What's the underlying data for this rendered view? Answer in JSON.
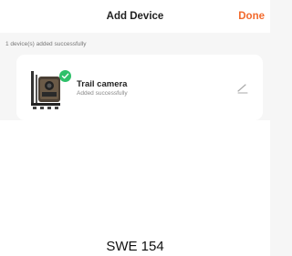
{
  "header": {
    "title": "Add Device",
    "done_label": "Done"
  },
  "status_text": "1 device(s) added successfully",
  "device": {
    "name": "Trail camera",
    "status": "Added successfully",
    "icon": "trail-camera-thumbnail",
    "edit_icon": "pencil-icon"
  },
  "footer": {
    "caption": "SWE 154"
  },
  "colors": {
    "accent": "#f26a2d",
    "success": "#2fc06a"
  }
}
